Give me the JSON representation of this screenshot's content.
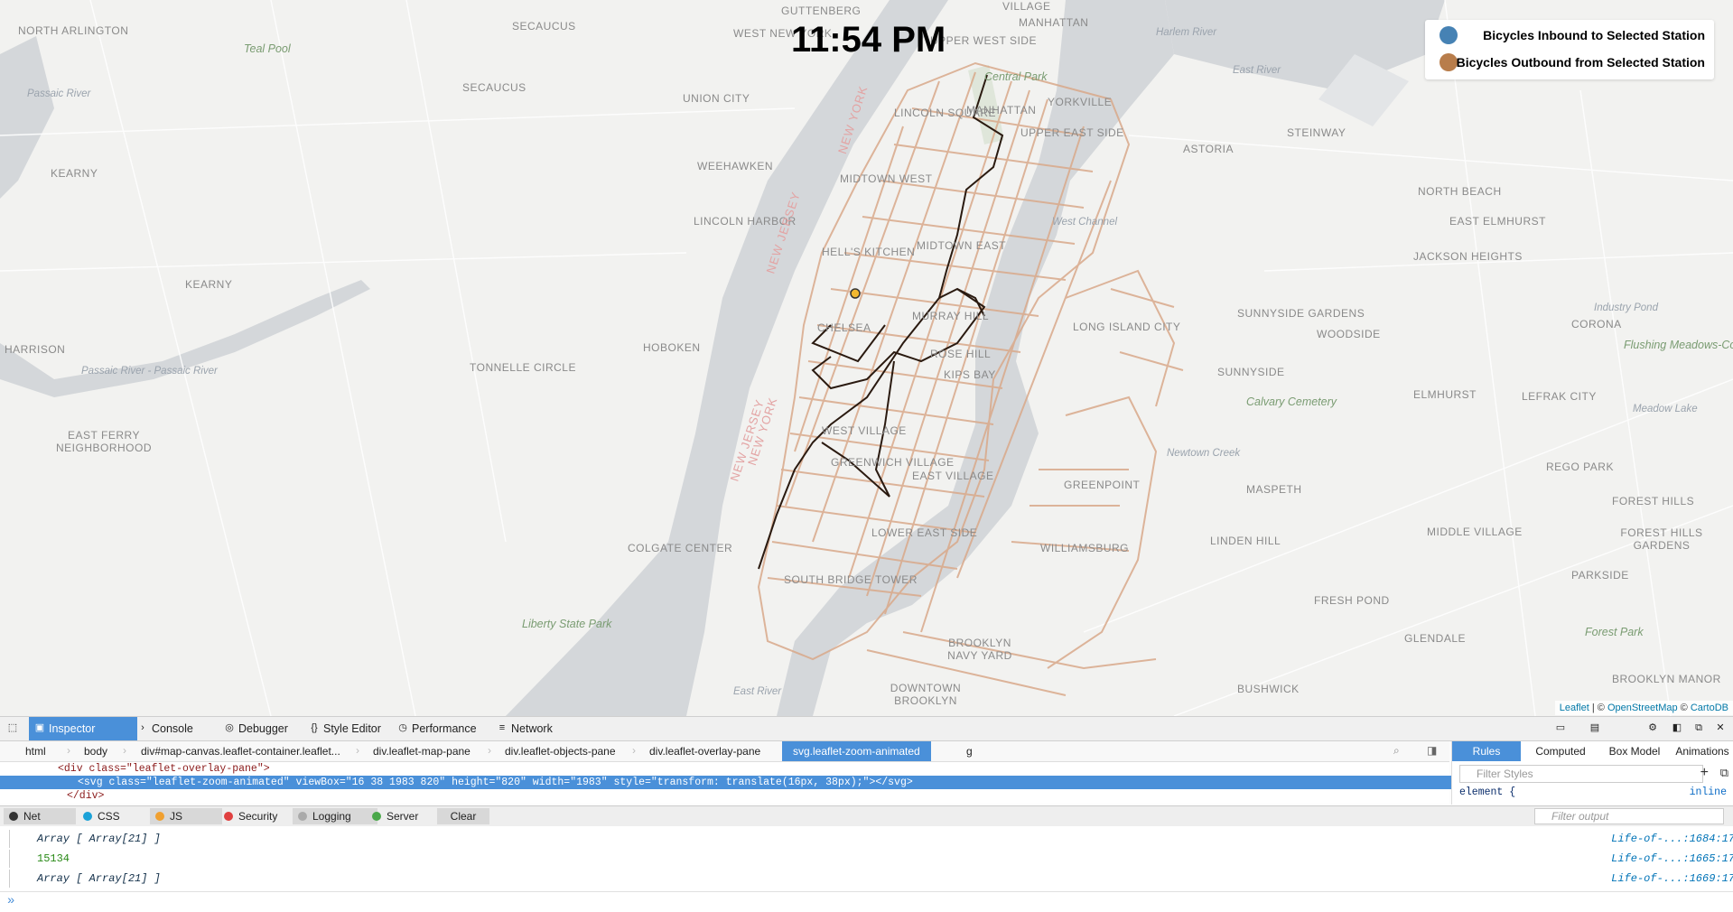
{
  "map": {
    "clock": "11:54 PM",
    "legend": {
      "items": [
        {
          "label": "Bicycles Inbound to Selected Station",
          "color": "#4682b4"
        },
        {
          "label": "Bicycles Outbound from Selected Station",
          "color": "#b87d4b"
        }
      ]
    },
    "route_color": "#d9a98a",
    "path_color": "#2a1a10",
    "labels": [
      "GUTTENBERG",
      "VILLAGE",
      "MANHATTAN",
      "WEST NEW YORK",
      "UPPER WEST SIDE",
      "SECAUCUS",
      "NORTH ARLINGTON",
      "Teal Pool",
      "Harlem River",
      "East River",
      "Central Park",
      "UNION CITY",
      "SECAUCUS",
      "Passaic River",
      "MANHATTAN",
      "YORKVILLE",
      "UPPER EAST SIDE",
      "ASTORIA",
      "STEINWAY",
      "LINCOLN SQUARE",
      "KEARNY",
      "WEEHAWKEN",
      "MIDTOWN WEST",
      "NORTH BEACH",
      "LINCOLN HARBOR",
      "HELL'S KITCHEN",
      "MIDTOWN EAST",
      "West Channel",
      "EAST ELMHURST",
      "KEARNY",
      "JACKSON HEIGHTS",
      "HARRISON",
      "MURRAY HILL",
      "SUNNYSIDE GARDENS",
      "WOODSIDE",
      "Industry Pond",
      "CORONA",
      "LONG ISLAND CITY",
      "CHELSEA",
      "HOBOKEN",
      "Flushing Meadows-Corona Park",
      "ROSE HILL",
      "TONNELLE CIRCLE",
      "KIPS BAY",
      "SUNNYSIDE",
      "ELMHURST",
      "LEFRAK CITY",
      "Passaic River - Passaic River",
      "Calvary Cemetery",
      "Meadow Lake",
      "EAST FERRY NEIGHBORHOOD",
      "WEST VILLAGE",
      "GREENWICH VILLAGE",
      "EAST VILLAGE",
      "Newtown Creek",
      "REGO PARK",
      "GREENPOINT",
      "MASPETH",
      "FOREST HILLS",
      "COLGATE CENTER",
      "LOWER EAST SIDE",
      "WILLIAMSBURG",
      "LINDEN HILL",
      "MIDDLE VILLAGE",
      "FOREST HILLS GARDENS",
      "SOUTH BRIDGE TOWER",
      "FRESH POND",
      "PARKSIDE",
      "Liberty State Park",
      "GLENDALE",
      "Forest Park",
      "BROOKLYN NAVY YARD",
      "DOWNTOWN BROOKLYN",
      "East River",
      "BUSHWICK",
      "BROOKLYN MANOR",
      "NEW JERSEY",
      "NEW YORK",
      "NEW JERSEY",
      "NEW YORK"
    ],
    "attribution": {
      "leaflet": "Leaflet",
      "sep": " | © ",
      "osm": "OpenStreetMap",
      "sep2": " © ",
      "carto": "CartoDB"
    }
  },
  "devtools": {
    "tools": [
      "Inspector",
      "Console",
      "Debugger",
      "Style Editor",
      "Performance",
      "Network"
    ],
    "breadcrumbs": [
      "html",
      "body",
      "div#map-canvas.leaflet-container.leaflet...",
      "div.leaflet-map-pane",
      "div.leaflet-objects-pane",
      "div.leaflet-overlay-pane",
      "svg.leaflet-zoom-animated",
      "g"
    ],
    "markup": {
      "line1": "<div class=\"leaflet-overlay-pane\">",
      "line2": "<svg class=\"leaflet-zoom-animated\" viewBox=\"16 38 1983 820\" height=\"820\" width=\"1983\" style=\"transform: translate(16px, 38px);\"></svg>",
      "line3": "</div>"
    },
    "rule_tabs": [
      "Rules",
      "Computed",
      "Box Model",
      "Animations"
    ],
    "filter_styles_placeholder": "Filter Styles",
    "rule_selector": "element {",
    "rule_source": "inline",
    "console_filters": [
      {
        "label": "Net",
        "color": "#333333"
      },
      {
        "label": "CSS",
        "color": "#1ba2d8"
      },
      {
        "label": "JS",
        "color": "#f0a030"
      },
      {
        "label": "Security",
        "color": "#e04040"
      },
      {
        "label": "Logging",
        "color": "#aaaaaa"
      },
      {
        "label": "Server",
        "color": "#4aa84a"
      }
    ],
    "clear_label": "Clear",
    "filter_output_placeholder": "Filter output",
    "console_lines": [
      {
        "text": "Array [ Array[21] ]",
        "source": "Life-of-...:1684:17"
      },
      {
        "text": "15134",
        "source": "Life-of-...:1665:17"
      },
      {
        "text": "Array [ Array[21] ]",
        "source": "Life-of-...:1669:17"
      }
    ],
    "prompt": "»"
  }
}
